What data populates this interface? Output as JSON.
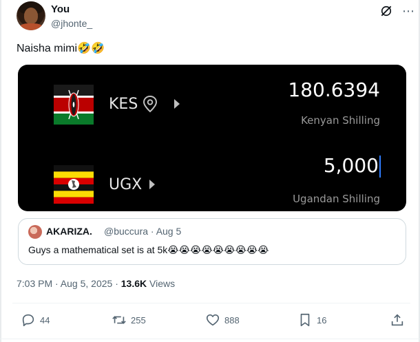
{
  "tweet": {
    "author_name": "You",
    "author_handle": "@jhonte_",
    "text": "Naisha mimi🤣🤣",
    "timestamp": "7:03 PM · Aug 5, 2025 · ",
    "views_count": "13.6K",
    "views_label": " Views"
  },
  "converter": {
    "from": {
      "code": "KES",
      "amount": "180.6394",
      "name": "Kenyan Shilling"
    },
    "to": {
      "code": "UGX",
      "amount": "5,000",
      "name": "Ugandan Shilling"
    }
  },
  "quote": {
    "author_name": "AKARIZA.",
    "meta": "@buccura · Aug 5",
    "text": "Guys a mathematical set is at 5k😭😭😭😭😭😭😭😭😭"
  },
  "actions": {
    "replies": "44",
    "reposts": "255",
    "likes": "888",
    "bookmarks": "16"
  },
  "colors": {
    "accent_blue": "#1d9bf0",
    "secondary_text": "#536471",
    "card_bg": "#000000",
    "caret_blue": "#2f7dff"
  }
}
